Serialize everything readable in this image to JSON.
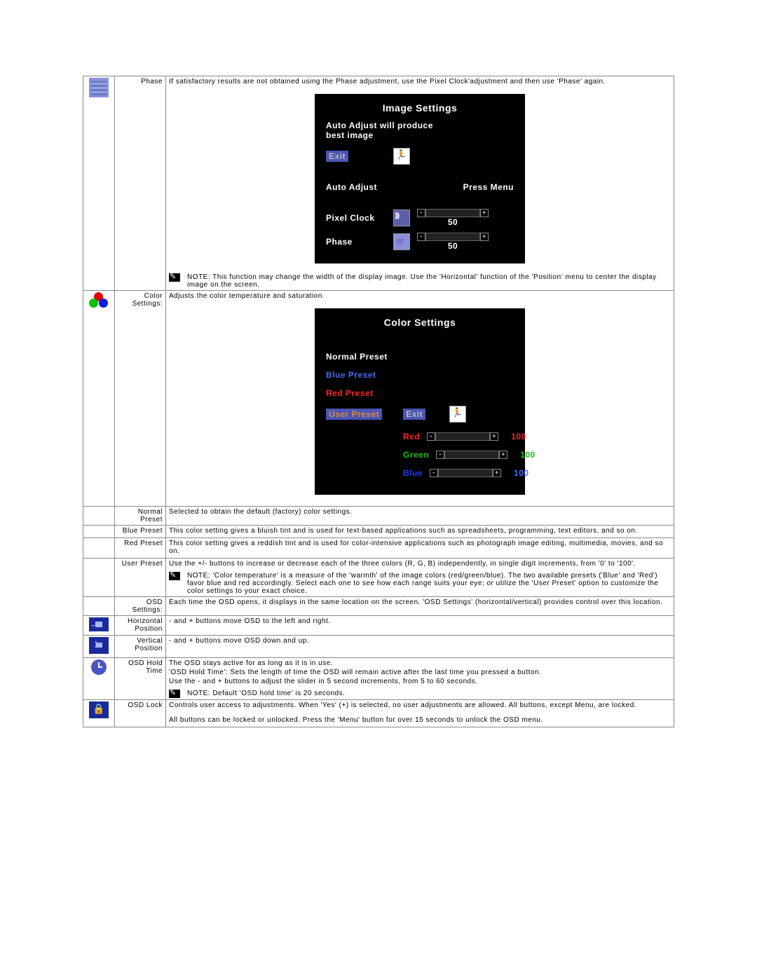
{
  "rows": {
    "phase": {
      "label": "Phase",
      "text": "If satisfactory results are not obtained using the Phase adjustment, use the Pixel Clock'adjustment and then use 'Phase' again.",
      "note": "NOTE: This function may change the width of the display image. Use the 'Horizontal' function of the 'Position' menu to center the display image on the screen."
    },
    "color": {
      "label": "Color Settings:",
      "text": "Adjusts the color temperature and saturation."
    },
    "normal": {
      "label": "Normal Preset",
      "text": "Selected to obtain the default (factory) color settings."
    },
    "blue": {
      "label": "Blue Preset",
      "text": "This color setting gives a bluish tint and is used for text-based applications such as spreadsheets, programming, text editors, and so on."
    },
    "red": {
      "label": "Red Preset",
      "text": "This color setting gives a reddish tint and is used for color-intensive applications such as photograph image editing, multimedia, movies, and so on."
    },
    "user": {
      "label": "User Preset",
      "text": "Use the +/- buttons to increase or decrease each of the three colors (R, G, B) independently, in single digit increments, from '0' to '100'.",
      "note": "NOTE: 'Color temperature' is a measure of the 'warmth' of the image colors (red/green/blue). The two available presets ('Blue' and 'Red') favor blue and red accordingly. Select each one to see how each range suits your eye; or utilize the 'User Preset' option to customize the color settings to your exact choice."
    },
    "osd": {
      "label": "OSD Settings:",
      "text": "Each time the OSD opens, it displays in the same location on the screen. 'OSD Settings' (horizontal/vertical) provides control over this location."
    },
    "hpos": {
      "label": "Horizontal Position",
      "text": "- and + buttons move OSD to the left and right."
    },
    "vpos": {
      "label": "Vertical Position",
      "text": "- and + buttons move OSD down and up."
    },
    "hold": {
      "label": "OSD Hold Time",
      "text1": "The OSD stays active for as long as it is in use.",
      "text2": "'OSD Hold Time': Sets the length of time the OSD will remain active after the last time you pressed a button.",
      "text3": "Use the - and + buttons to adjust the slider in 5 second increments, from 5 to 60 seconds.",
      "note": "NOTE: Default 'OSD hold time' is 20 seconds."
    },
    "lock": {
      "label": "OSD Lock",
      "text1": "Controls user access to adjustments. When 'Yes' (+) is selected, no user adjustments are allowed. All buttons, except Menu, are locked.",
      "text2": "All buttons can be locked or unlocked. Press the 'Menu' button for over 15 seconds to unlock the OSD menu."
    }
  },
  "osd1": {
    "title": "Image Settings",
    "msg1": "Auto Adjust will produce",
    "msg2": "best image",
    "exit": "Exit",
    "auto": "Auto Adjust",
    "press": "Press Menu",
    "pclock": "Pixel Clock",
    "pval": "50",
    "phase": "Phase",
    "phval": "50"
  },
  "osd2": {
    "title": "Color Settings",
    "normal": "Normal Preset",
    "blue": "Blue Preset",
    "red": "Red Preset",
    "user": "User Preset",
    "exit": "Exit",
    "r": "Red",
    "rv": "100",
    "g": "Green",
    "gv": "100",
    "b": "Blue",
    "bv": "100"
  }
}
